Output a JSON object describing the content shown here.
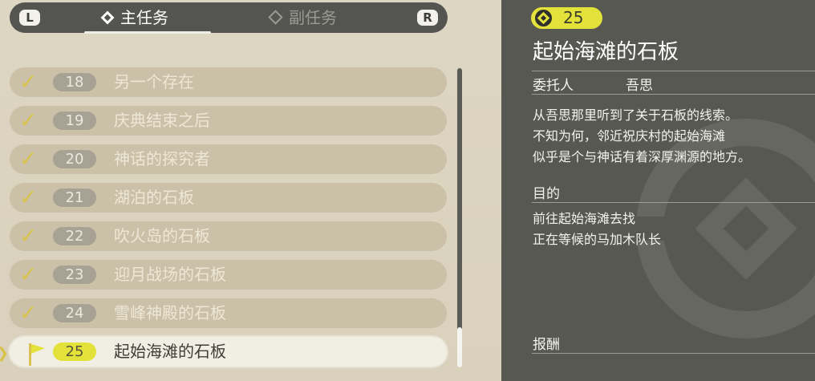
{
  "tabs": {
    "left_button": "L",
    "right_button": "R",
    "main_label": "主任务",
    "side_label": "副任务"
  },
  "quests": [
    {
      "num": "18",
      "title": "另一个存在",
      "status": "completed"
    },
    {
      "num": "19",
      "title": "庆典结束之后",
      "status": "completed"
    },
    {
      "num": "20",
      "title": "神话的探究者",
      "status": "completed"
    },
    {
      "num": "21",
      "title": "湖泊的石板",
      "status": "completed"
    },
    {
      "num": "22",
      "title": "吹火岛的石板",
      "status": "completed"
    },
    {
      "num": "23",
      "title": "迎月战场的石板",
      "status": "completed"
    },
    {
      "num": "24",
      "title": "雪峰神殿的石板",
      "status": "completed"
    },
    {
      "num": "25",
      "title": "起始海滩的石板",
      "status": "active"
    }
  ],
  "detail": {
    "number": "25",
    "title": "起始海滩的石板",
    "client_label": "委托人",
    "client_name": "吾思",
    "description": [
      "从吾思那里听到了关于石板的线索。",
      "不知为何，邻近祝庆村的起始海滩",
      "似乎是个与神话有着深厚渊源的地方。"
    ],
    "objective_label": "目的",
    "objective": [
      "前往起始海滩去找",
      "正在等候的马加木队长"
    ],
    "reward_label": "报酬"
  },
  "colors": {
    "accent_yellow": "#e3e23b",
    "panel_dark": "#585853",
    "list_bg": "#ddd6c2"
  },
  "icons": [
    "check-icon",
    "flag-icon",
    "quest-diamond-icon",
    "cursor-arrow-icon"
  ]
}
